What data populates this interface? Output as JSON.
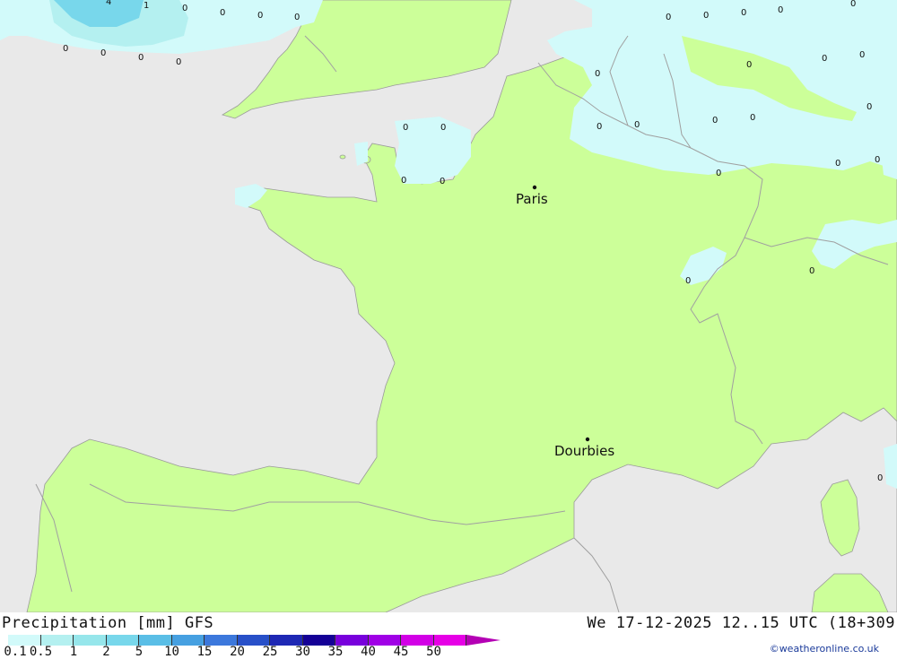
{
  "map": {
    "cities": [
      {
        "name": "Paris"
      },
      {
        "name": "Dourbies"
      }
    ],
    "contour_labels": [
      "0",
      "0",
      "0",
      "0",
      "0",
      "0",
      "0",
      "0",
      "0",
      "0",
      "0",
      "0",
      "0",
      "0",
      "0",
      "0",
      "0",
      "0",
      "0",
      "0",
      "0",
      "0",
      "0",
      "0",
      "0",
      "0",
      "0",
      "0",
      "0",
      "0",
      "0",
      "0",
      "4",
      "1"
    ]
  },
  "legend": {
    "title": "Precipitation [mm] GFS",
    "ticks": [
      "0.1",
      "0.5",
      "1",
      "2",
      "5",
      "10",
      "15",
      "20",
      "25",
      "30",
      "35",
      "40",
      "45",
      "50"
    ],
    "colors": [
      "#d2fafa",
      "#b4f0f0",
      "#96e6eb",
      "#78d7eb",
      "#5abee6",
      "#46a0e1",
      "#3c78dc",
      "#2850c8",
      "#1e28b4",
      "#140096",
      "#7800dc",
      "#a000e6",
      "#d200e6",
      "#e600e6",
      "#b400b4"
    ]
  },
  "timestamp": "We 17-12-2025 12..15 UTC (18+309",
  "credit": "©weatheronline.co.uk",
  "colors": {
    "sea": "#e9e9e9",
    "land": "#ccff99",
    "precip_light": "#d2fafa",
    "precip_medium": "#b4f0f0",
    "precip_heavy": "#78d7eb",
    "border": "#a0a0a0"
  }
}
